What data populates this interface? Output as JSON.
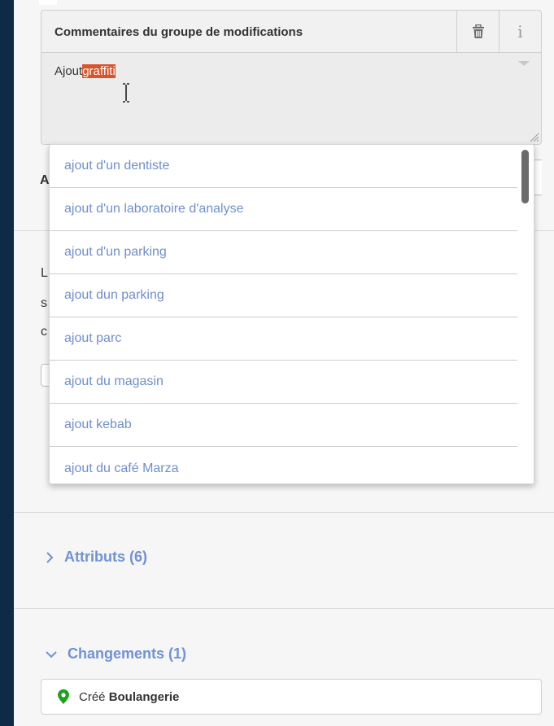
{
  "comment_card": {
    "title": "Commentaires du groupe de modifications",
    "delete_icon": "trash-icon",
    "info_icon": "info-icon",
    "info_glyph": "i",
    "text_typed": "Ajout",
    "text_selected": "graffiti"
  },
  "background_peek": {
    "letter_a": "A",
    "letter_l": "L",
    "letter_s": "s",
    "letter_c": "c"
  },
  "suggestions": [
    "ajout d'un dentiste",
    "ajout d'un laboratoire d'analyse",
    "ajout d'un parking",
    "ajout dun parking",
    "ajout parc",
    "ajout du magasin",
    "ajout kebab",
    "ajout du café Marza"
  ],
  "attributes_section": {
    "label": "Attributs (6)",
    "icon": "chevron-right-icon"
  },
  "changes_section": {
    "label": "Changements (1)",
    "icon": "chevron-down-icon",
    "items": [
      {
        "action": "Créé",
        "name": "Boulangerie",
        "icon": "map-pin-icon"
      }
    ]
  },
  "colors": {
    "selection": "#d9532b",
    "link": "#7092d4",
    "suggestion_text": "#6f8fcc",
    "pin": "#20a020",
    "background": "#0d2b46"
  }
}
